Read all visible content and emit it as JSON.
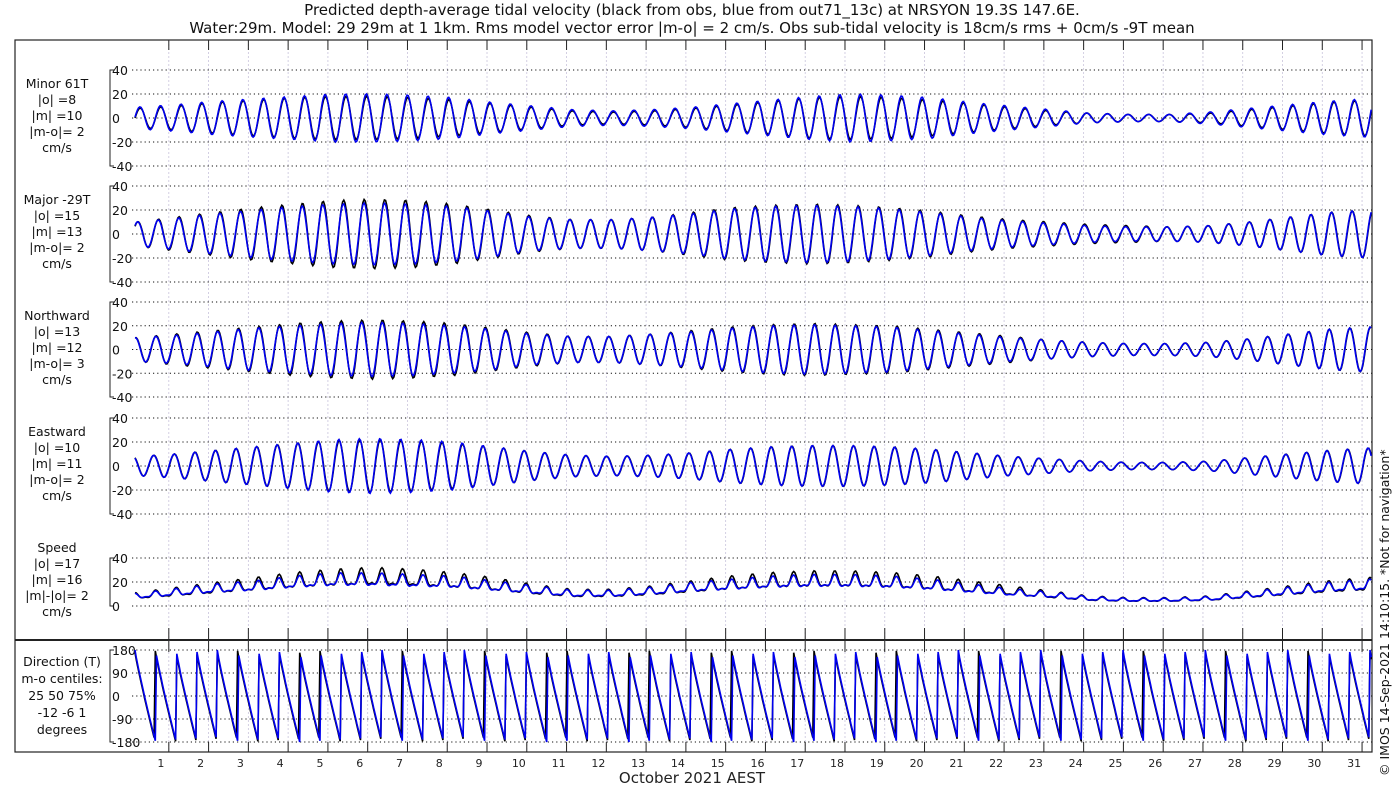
{
  "chart_data": {
    "type": "line",
    "title": "Predicted depth-average tidal velocity (black from obs, blue from out71_13c) at NRSYON 19.3S 147.6E.",
    "subtitle": "Water:29m. Model: 29 29m at 1 1km. Rms model vector error |m-o| = 2 cm/s. Obs sub-tidal velocity is 18cm/s rms + 0cm/s -9T mean",
    "xlabel": "October 2021 AEST",
    "x_tick_labels": [
      "1",
      "2",
      "3",
      "4",
      "5",
      "6",
      "7",
      "8",
      "9",
      "10",
      "11",
      "12",
      "13",
      "14",
      "15",
      "16",
      "17",
      "18",
      "19",
      "20",
      "21",
      "22",
      "23",
      "24",
      "25",
      "26",
      "27",
      "28",
      "29",
      "30",
      "31"
    ],
    "xlim_days": [
      0,
      31.1
    ],
    "legend": [
      {
        "name": "obs",
        "color": "#000000"
      },
      {
        "name": "model (out71_13c)",
        "color": "#0000ee"
      }
    ],
    "watermark": "© IMOS 14-Sep-2021 14:10:15. *Not for navigation*",
    "tidal_period_hours": 12.42,
    "panels": [
      {
        "key": "minor",
        "labels": [
          "Minor 61T",
          "|o| =8",
          "|m| =10",
          "|m-o|= 2",
          "cm/s"
        ],
        "ylim": [
          -40,
          40
        ],
        "yticks": [
          "40",
          "20",
          "0",
          "-20",
          "-40"
        ],
        "obs_daily_amplitude": [
          8,
          10,
          13,
          15,
          17,
          18,
          18,
          17,
          15,
          12,
          9,
          6,
          5,
          6,
          8,
          11,
          14,
          17,
          18,
          17,
          15,
          12,
          9,
          6,
          4,
          3,
          3,
          4,
          7,
          10,
          13,
          15
        ],
        "model_daily_amplitude": [
          9,
          11,
          14,
          16,
          18,
          20,
          20,
          19,
          17,
          13,
          10,
          7,
          6,
          7,
          9,
          12,
          15,
          18,
          20,
          19,
          17,
          13,
          10,
          7,
          4,
          3,
          3,
          5,
          8,
          11,
          14,
          16
        ]
      },
      {
        "key": "major",
        "labels": [
          "Major -29T",
          "|o| =15",
          "|m| =13",
          "|m-o|= 2",
          "cm/s"
        ],
        "ylim": [
          -40,
          40
        ],
        "yticks": [
          "40",
          "20",
          "0",
          "-20",
          "-40"
        ],
        "obs_daily_amplitude": [
          10,
          14,
          18,
          22,
          25,
          28,
          29,
          28,
          25,
          20,
          15,
          12,
          12,
          14,
          18,
          22,
          24,
          25,
          24,
          22,
          19,
          15,
          12,
          10,
          8,
          7,
          6,
          7,
          10,
          14,
          18,
          20
        ],
        "model_daily_amplitude": [
          10,
          13,
          17,
          20,
          23,
          25,
          26,
          25,
          23,
          19,
          14,
          12,
          12,
          14,
          17,
          21,
          23,
          24,
          23,
          21,
          18,
          14,
          11,
          9,
          7,
          6,
          6,
          7,
          10,
          14,
          18,
          20
        ]
      },
      {
        "key": "northward",
        "labels": [
          "Northward",
          "|o| =13",
          "|m| =12",
          "|m-o|= 3",
          "cm/s"
        ],
        "ylim": [
          -40,
          40
        ],
        "yticks": [
          "40",
          "20",
          "0",
          "-20",
          "-40"
        ],
        "obs_daily_amplitude": [
          10,
          13,
          16,
          19,
          22,
          24,
          25,
          24,
          22,
          18,
          14,
          11,
          11,
          13,
          16,
          19,
          21,
          22,
          21,
          20,
          17,
          14,
          11,
          8,
          6,
          5,
          5,
          6,
          9,
          13,
          17,
          19
        ],
        "model_daily_amplitude": [
          10,
          12,
          15,
          18,
          20,
          22,
          23,
          22,
          20,
          17,
          13,
          11,
          11,
          13,
          15,
          18,
          20,
          21,
          20,
          19,
          16,
          13,
          10,
          8,
          6,
          5,
          5,
          6,
          9,
          13,
          17,
          19
        ]
      },
      {
        "key": "eastward",
        "labels": [
          "Eastward",
          "|o| =10",
          "|m| =11",
          "|m-o|= 2",
          "cm/s"
        ],
        "ylim": [
          -40,
          40
        ],
        "yticks": [
          "40",
          "20",
          "0",
          "-20",
          "-40"
        ],
        "obs_daily_amplitude": [
          8,
          10,
          13,
          16,
          19,
          21,
          22,
          21,
          19,
          16,
          12,
          9,
          8,
          9,
          11,
          14,
          16,
          17,
          17,
          16,
          14,
          11,
          8,
          6,
          4,
          3,
          3,
          4,
          7,
          10,
          13,
          15
        ],
        "model_daily_amplitude": [
          8,
          10,
          13,
          16,
          19,
          22,
          23,
          22,
          20,
          16,
          12,
          9,
          8,
          9,
          11,
          14,
          16,
          17,
          17,
          16,
          14,
          11,
          8,
          6,
          4,
          3,
          3,
          4,
          7,
          10,
          13,
          15
        ]
      },
      {
        "key": "speed",
        "labels": [
          "Speed",
          "|o| =17",
          "|m| =16",
          "|m|-|o|= 2",
          "cm/s"
        ],
        "ylim": [
          0,
          40
        ],
        "yticks": [
          "40",
          "20",
          "0"
        ],
        "obs_daily_mean": [
          8,
          11,
          14,
          17,
          20,
          22,
          23,
          22,
          20,
          17,
          13,
          10,
          10,
          12,
          15,
          18,
          20,
          21,
          21,
          20,
          18,
          15,
          12,
          9,
          6,
          5,
          5,
          6,
          9,
          12,
          15,
          17
        ],
        "model_daily_mean": [
          8,
          11,
          14,
          16,
          19,
          21,
          21,
          20,
          19,
          16,
          13,
          10,
          10,
          12,
          15,
          17,
          19,
          20,
          20,
          19,
          17,
          14,
          11,
          9,
          6,
          5,
          5,
          6,
          9,
          12,
          15,
          17
        ]
      },
      {
        "key": "direction",
        "labels": [
          "Direction (T)",
          "m-o centiles:",
          "25  50  75%",
          "-12  -6   1",
          "degrees"
        ],
        "ylim": [
          -180,
          180
        ],
        "yticks": [
          "180",
          "90",
          "0",
          "-90",
          "-180"
        ],
        "centiles_percent": [
          25,
          50,
          75
        ],
        "centiles_deg": [
          -12,
          -6,
          1
        ]
      }
    ]
  }
}
